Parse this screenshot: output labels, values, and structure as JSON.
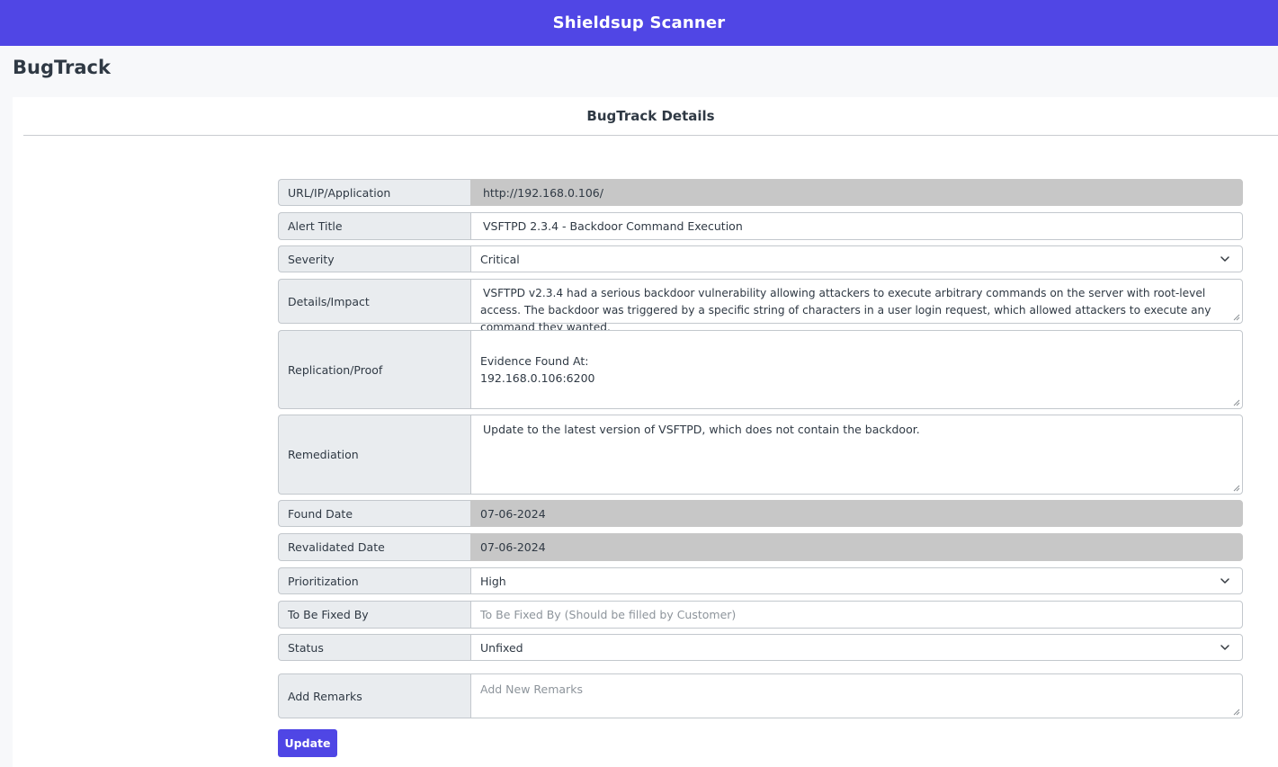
{
  "header": {
    "brand": "Shieldsup Scanner"
  },
  "page": {
    "title": "BugTrack"
  },
  "card": {
    "title": "BugTrack Details"
  },
  "fields": {
    "url": {
      "label": "URL/IP/Application",
      "value": "http://192.168.0.106/"
    },
    "alert_title": {
      "label": "Alert Title",
      "value": "VSFTPD 2.3.4 - Backdoor Command Execution"
    },
    "severity": {
      "label": "Severity",
      "value": "Critical"
    },
    "details": {
      "label": "Details/Impact",
      "value": "VSFTPD v2.3.4 had a serious backdoor vulnerability allowing attackers to execute arbitrary commands on the server with root-level access. The backdoor was triggered by a specific string of characters in a user login request, which allowed attackers to execute any command they wanted."
    },
    "replication": {
      "label": "Replication/Proof",
      "line1": "Evidence Found At:",
      "line2": "192.168.0.106:6200"
    },
    "remediation": {
      "label": "Remediation",
      "value": "Update to the latest version of VSFTPD, which does not contain the backdoor."
    },
    "found_date": {
      "label": "Found Date",
      "value": "07-06-2024"
    },
    "revalidated_date": {
      "label": "Revalidated Date",
      "value": "07-06-2024"
    },
    "prioritization": {
      "label": "Prioritization",
      "value": "High"
    },
    "to_be_fixed_by": {
      "label": "To Be Fixed By",
      "placeholder": "To Be Fixed By (Should be filled by Customer)"
    },
    "status": {
      "label": "Status",
      "value": "Unfixed"
    },
    "remarks": {
      "label": "Add Remarks",
      "placeholder": "Add New Remarks"
    }
  },
  "actions": {
    "update_label": "Update"
  },
  "icons": {
    "select_arrow": "chevron-down-icon",
    "textarea_resize": "resize-handle-icon"
  },
  "colors": {
    "brand": "#5046e5",
    "button": "#4f46e5",
    "readonly": "#c7c7c7"
  }
}
